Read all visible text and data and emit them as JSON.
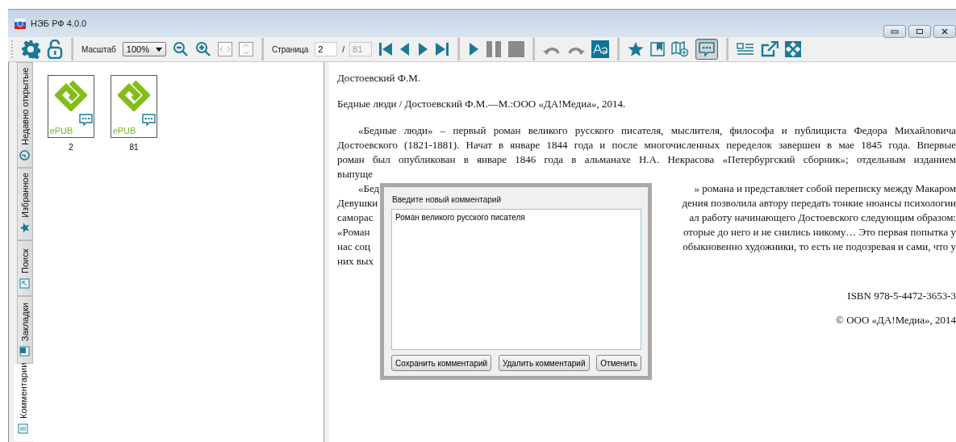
{
  "window": {
    "title": "НЭБ РФ 4.0.0"
  },
  "toolbar": {
    "zoom_label": "Масштаб",
    "zoom_value": "100%",
    "page_label": "Страница",
    "page_value": "2",
    "page_separator": "/",
    "page_total": "81",
    "playback": [
      {
        "disabled": false
      },
      {
        "disabled": true
      },
      {
        "disabled": true
      }
    ],
    "history": [
      {
        "disabled": true
      },
      {
        "disabled": true
      }
    ],
    "comments_pressed": true
  },
  "side_tabs": [
    {
      "label": "Недавно открытые",
      "selected": false
    },
    {
      "label": "Избранное",
      "selected": false
    },
    {
      "label": "Поиск",
      "selected": false
    },
    {
      "label": "Закладки",
      "selected": false
    },
    {
      "label": "Комментарии",
      "selected": true
    }
  ],
  "thumbnails": [
    {
      "logo": "ePUB",
      "page": "2",
      "has_comment": true
    },
    {
      "logo": "ePUB",
      "page": "81",
      "has_comment": true
    }
  ],
  "document": {
    "author": "Достоевский Ф.М.",
    "citation": "Бедные люди / Достоевский Ф.М.—М.:ООО «ДА!Медиа», 2014.",
    "lines": [
      {
        "left": "«Бедные люди» – первый роман великого русского писателя, мыслителя, философа и публициста Федора Михайловича",
        "indent": true
      },
      {
        "left": "Достоевского (1821-1881). Начат в январе 1844 года и после многочисленных переделок завершен в мае 1845 года. Впервые",
        "indent": false
      },
      {
        "left": "роман был опубликован в январе 1846 года в альманахе Н.А. Некрасова «Петербургский сборник»; отдельным изданием",
        "indent": false
      },
      {
        "left": "выпуще",
        "indent": false
      },
      {
        "left": "«Бед",
        "right": "» романа и представляет собой переписку между Макаром",
        "indent": true
      },
      {
        "left": "Девушки",
        "right": "дения позволила автору передать тонкие нюансы психологии",
        "indent": false
      },
      {
        "left": "саморас",
        "right": "ал работу начинающего Достоевского следующим образом:",
        "indent": false
      },
      {
        "left": "«Роман",
        "right": "оторые до него и не снились никому… Это первая попытка у",
        "indent": false
      },
      {
        "left": "нас соц",
        "right": "обыкновенно художники, то есть не подозревая и сами, что у",
        "indent": false
      },
      {
        "left": "них вых",
        "indent": false
      }
    ],
    "isbn": "ISBN 978-5-4472-3653-3",
    "copyright": "© ООО «ДА!Медиа», 2014"
  },
  "dialog": {
    "prompt": "Введите новый комментарий",
    "value": "Роман великого русского писателя",
    "buttons": [
      "Сохранить комментарий",
      "Удалить комментарий",
      "Отменить"
    ]
  }
}
